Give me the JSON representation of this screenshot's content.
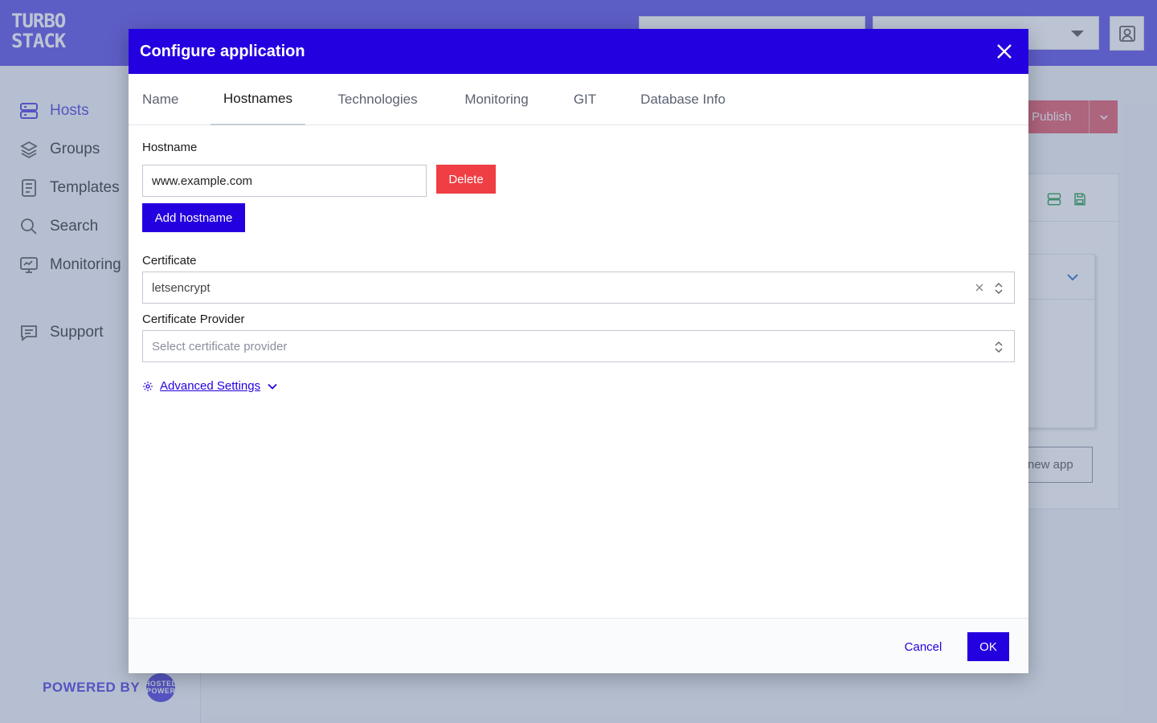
{
  "app": {
    "logo_line1": "TURBO",
    "logo_line2": "STACK"
  },
  "sidebar": {
    "items": [
      {
        "label": "Hosts",
        "icon": "server-icon",
        "active": true
      },
      {
        "label": "Groups",
        "icon": "layers-icon"
      },
      {
        "label": "Templates",
        "icon": "document-icon"
      },
      {
        "label": "Search",
        "icon": "search-icon"
      },
      {
        "label": "Monitoring",
        "icon": "monitor-icon"
      },
      {
        "label": "Support",
        "icon": "chat-icon"
      }
    ],
    "powered_by": "POWERED BY",
    "powered_logo": "HOSTED POWER"
  },
  "background": {
    "publish_label": "& Publish",
    "new_app_label": "new app"
  },
  "modal": {
    "title": "Configure application",
    "tabs": [
      {
        "label": "Name"
      },
      {
        "label": "Hostnames",
        "active": true
      },
      {
        "label": "Technologies"
      },
      {
        "label": "Monitoring"
      },
      {
        "label": "GIT"
      },
      {
        "label": "Database Info"
      }
    ],
    "hostname": {
      "label": "Hostname",
      "value": "www.example.com",
      "delete_label": "Delete",
      "add_label": "Add hostname"
    },
    "certificate": {
      "label": "Certificate",
      "value": "letsencrypt"
    },
    "certificate_provider": {
      "label": "Certificate Provider",
      "placeholder": "Select certificate provider"
    },
    "advanced_label": "Advanced Settings",
    "footer": {
      "cancel_label": "Cancel",
      "ok_label": "OK"
    }
  },
  "colors": {
    "brand": "#2300e0",
    "topbar": "#5c4ee8",
    "danger": "#ef3e44"
  }
}
